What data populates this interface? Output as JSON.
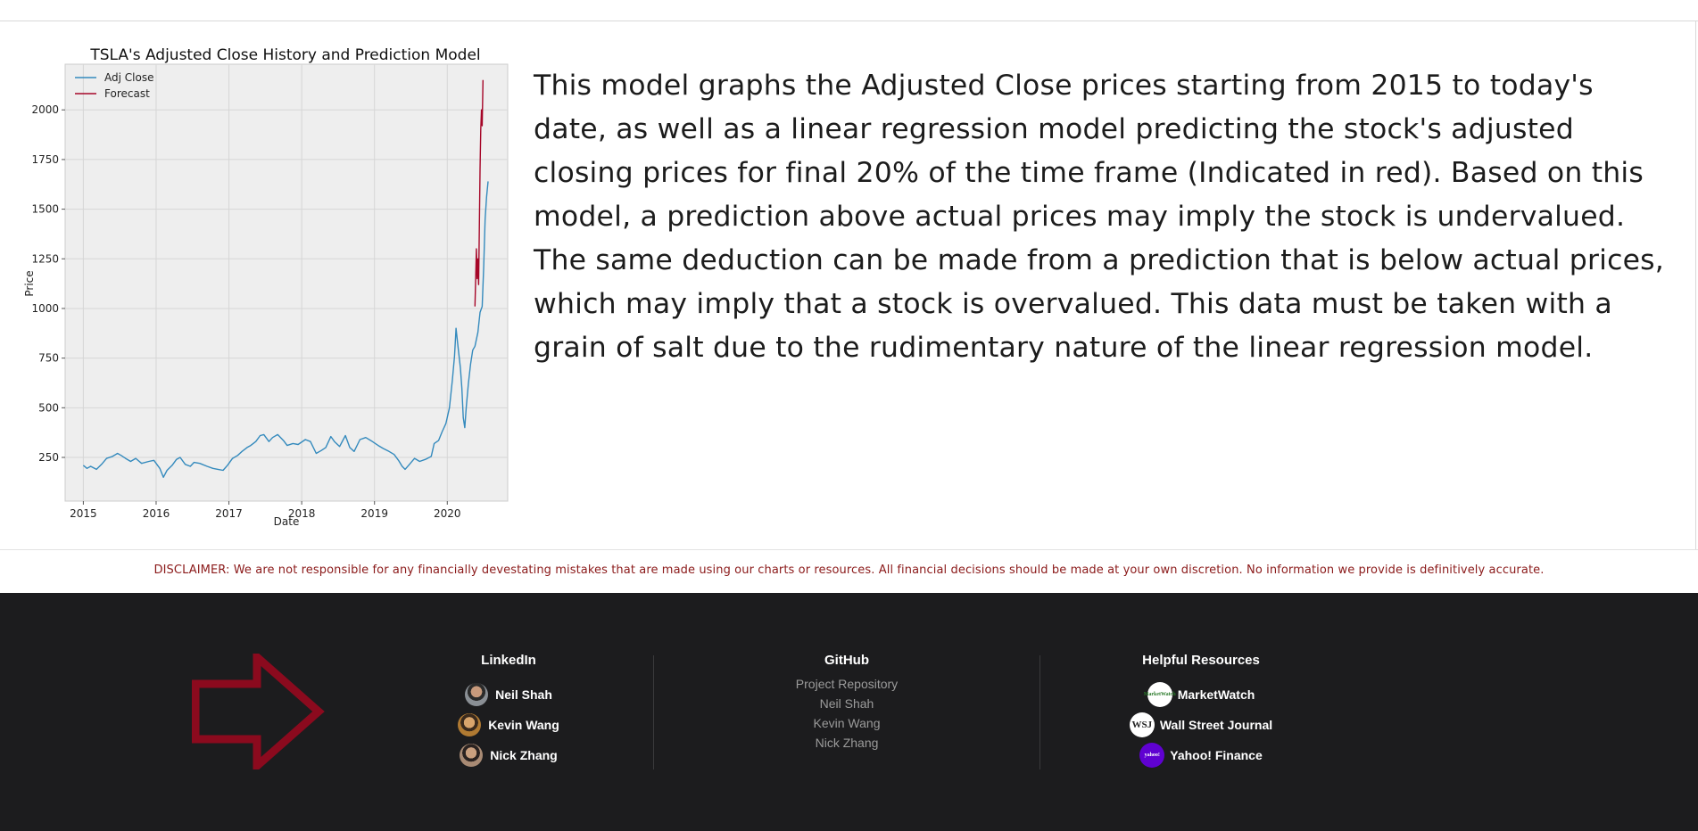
{
  "chart_data": {
    "type": "line",
    "title": "TSLA's Adjusted Close History and Prediction Model",
    "xlabel": "Date",
    "ylabel": "Price",
    "xlim": [
      2014.75,
      2020.83
    ],
    "ylim": [
      30,
      2230
    ],
    "x_ticks": [
      "2015",
      "2016",
      "2017",
      "2018",
      "2019",
      "2020"
    ],
    "y_ticks": [
      "250",
      "500",
      "750",
      "1000",
      "1250",
      "1500",
      "1750",
      "2000"
    ],
    "grid": true,
    "legend_position": "top-left",
    "series": [
      {
        "name": "Adj Close",
        "color": "#348abd",
        "points": [
          [
            2015.0,
            210
          ],
          [
            2015.05,
            195
          ],
          [
            2015.1,
            205
          ],
          [
            2015.18,
            190
          ],
          [
            2015.25,
            215
          ],
          [
            2015.32,
            245
          ],
          [
            2015.4,
            255
          ],
          [
            2015.47,
            270
          ],
          [
            2015.52,
            260
          ],
          [
            2015.58,
            245
          ],
          [
            2015.65,
            230
          ],
          [
            2015.72,
            245
          ],
          [
            2015.8,
            220
          ],
          [
            2015.9,
            230
          ],
          [
            2015.97,
            235
          ],
          [
            2016.05,
            195
          ],
          [
            2016.1,
            150
          ],
          [
            2016.15,
            185
          ],
          [
            2016.22,
            210
          ],
          [
            2016.28,
            240
          ],
          [
            2016.33,
            250
          ],
          [
            2016.4,
            215
          ],
          [
            2016.47,
            205
          ],
          [
            2016.52,
            225
          ],
          [
            2016.6,
            220
          ],
          [
            2016.7,
            205
          ],
          [
            2016.78,
            195
          ],
          [
            2016.85,
            190
          ],
          [
            2016.92,
            185
          ],
          [
            2016.98,
            210
          ],
          [
            2017.05,
            245
          ],
          [
            2017.12,
            260
          ],
          [
            2017.18,
            280
          ],
          [
            2017.25,
            300
          ],
          [
            2017.3,
            310
          ],
          [
            2017.37,
            330
          ],
          [
            2017.43,
            360
          ],
          [
            2017.48,
            365
          ],
          [
            2017.55,
            330
          ],
          [
            2017.6,
            350
          ],
          [
            2017.67,
            365
          ],
          [
            2017.75,
            335
          ],
          [
            2017.8,
            310
          ],
          [
            2017.88,
            320
          ],
          [
            2017.95,
            315
          ],
          [
            2018.05,
            340
          ],
          [
            2018.12,
            330
          ],
          [
            2018.2,
            270
          ],
          [
            2018.27,
            285
          ],
          [
            2018.33,
            300
          ],
          [
            2018.4,
            355
          ],
          [
            2018.45,
            330
          ],
          [
            2018.52,
            305
          ],
          [
            2018.6,
            360
          ],
          [
            2018.66,
            300
          ],
          [
            2018.72,
            280
          ],
          [
            2018.8,
            340
          ],
          [
            2018.88,
            350
          ],
          [
            2018.95,
            335
          ],
          [
            2019.05,
            310
          ],
          [
            2019.12,
            295
          ],
          [
            2019.2,
            280
          ],
          [
            2019.27,
            265
          ],
          [
            2019.33,
            235
          ],
          [
            2019.38,
            205
          ],
          [
            2019.42,
            190
          ],
          [
            2019.48,
            215
          ],
          [
            2019.55,
            245
          ],
          [
            2019.62,
            230
          ],
          [
            2019.7,
            240
          ],
          [
            2019.78,
            255
          ],
          [
            2019.82,
            320
          ],
          [
            2019.88,
            335
          ],
          [
            2019.93,
            380
          ],
          [
            2019.98,
            420
          ],
          [
            2020.03,
            500
          ],
          [
            2020.07,
            640
          ],
          [
            2020.1,
            760
          ],
          [
            2020.12,
            900
          ],
          [
            2020.15,
            800
          ],
          [
            2020.18,
            700
          ],
          [
            2020.2,
            600
          ],
          [
            2020.22,
            450
          ],
          [
            2020.24,
            400
          ],
          [
            2020.26,
            500
          ],
          [
            2020.29,
            620
          ],
          [
            2020.32,
            720
          ],
          [
            2020.35,
            790
          ],
          [
            2020.38,
            810
          ],
          [
            2020.42,
            880
          ],
          [
            2020.45,
            980
          ],
          [
            2020.48,
            1010
          ],
          [
            2020.5,
            1210
          ],
          [
            2020.52,
            1450
          ],
          [
            2020.54,
            1560
          ],
          [
            2020.56,
            1640
          ]
        ]
      },
      {
        "name": "Forecast",
        "color": "#a60628",
        "points": [
          [
            2020.38,
            1010
          ],
          [
            2020.39,
            1150
          ],
          [
            2020.4,
            1300
          ],
          [
            2020.41,
            1150
          ],
          [
            2020.42,
            1250
          ],
          [
            2020.43,
            1120
          ],
          [
            2020.44,
            1400
          ],
          [
            2020.45,
            1700
          ],
          [
            2020.46,
            1900
          ],
          [
            2020.47,
            2000
          ],
          [
            2020.48,
            1920
          ],
          [
            2020.49,
            2150
          ]
        ]
      }
    ]
  },
  "description": "This model graphs the Adjusted Close prices starting from 2015 to today's date, as well as a linear regression model predicting the stock's adjusted closing prices for final 20% of the time frame (Indicated in red). Based on this model, a prediction above actual prices may imply the stock is undervalued. The same deduction can be made from a prediction that is below actual prices, which may imply that a stock is overvalued. This data must be taken with a grain of salt due to the rudimentary nature of the linear regression model.",
  "disclaimer": "DISCLAIMER: We are not responsible for any financially devestating mistakes that are made using our charts or resources. All financial decisions should be made at your own discretion. No information we provide is definitively accurate.",
  "footer": {
    "arrow_color": "#8b0a1e",
    "linkedin": {
      "title": "LinkedIn",
      "links": [
        {
          "label": "Neil Shah"
        },
        {
          "label": "Kevin Wang"
        },
        {
          "label": "Nick Zhang"
        }
      ]
    },
    "github": {
      "title": "GitHub",
      "links": [
        {
          "label": "Project Repository"
        },
        {
          "label": "Neil Shah"
        },
        {
          "label": "Kevin Wang"
        },
        {
          "label": "Nick Zhang"
        }
      ]
    },
    "resources": {
      "title": "Helpful Resources",
      "links": [
        {
          "label": "MarketWatch",
          "icon_text": "MarketWatch"
        },
        {
          "label": "Wall Street Journal",
          "icon_text": "WSJ"
        },
        {
          "label": "Yahoo! Finance",
          "icon_text": "yahoo!"
        }
      ]
    }
  }
}
